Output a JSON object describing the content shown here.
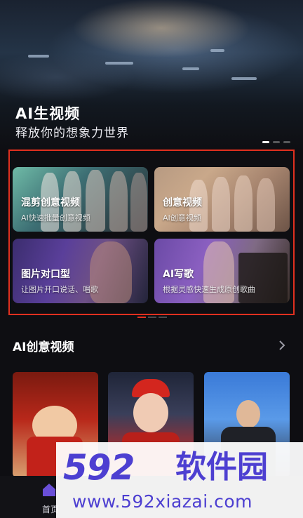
{
  "hero": {
    "title": "AI生视频",
    "subtitle": "释放你的想象力世界"
  },
  "cards": [
    {
      "title": "混剪创意视频",
      "desc": "AI快速批量创意视频"
    },
    {
      "title": "创意视频",
      "desc": "AI创意视频"
    },
    {
      "title": "图片对口型",
      "desc": "让图片开口说话、唱歌"
    },
    {
      "title": "AI写歌",
      "desc": "根据灵感快速生成原创歌曲"
    }
  ],
  "section": {
    "title": "AI创意视频"
  },
  "tabbar": {
    "home_label": "首页"
  },
  "watermark": {
    "brand": "592",
    "name": "软件园",
    "url": "www.592xiazai.com"
  },
  "colors": {
    "highlight": "#e0301f",
    "watermark": "#4d3fd1"
  }
}
